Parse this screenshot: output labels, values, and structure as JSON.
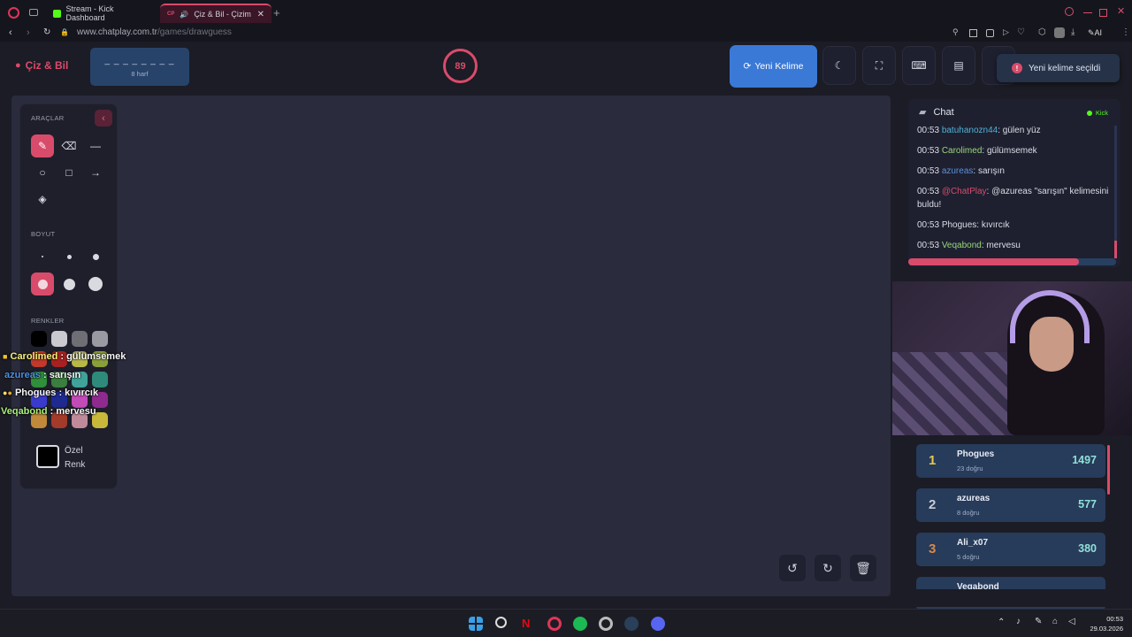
{
  "browser": {
    "tabs": [
      {
        "label": "Stream - Kick Dashboard"
      },
      {
        "label": "Çiz & Bil - Çizim Oy"
      }
    ],
    "url_domain": "www.chatplay.com.tr",
    "url_path": "/games/drawguess",
    "ai_label": "AI"
  },
  "header": {
    "app_title": "Çiz & Bil",
    "word_mask": "_ _ _ _ _ _ _ _",
    "word_length": "8 harf",
    "timer": "89",
    "new_word_label": "Yeni Kelime",
    "toast": "Yeni kelime seçildi"
  },
  "tools": {
    "section_tools": "ARAÇLAR",
    "section_size": "BOYUT",
    "section_colors": "RENKLER",
    "custom_color_line1": "Özel",
    "custom_color_line2": "Renk",
    "colors": [
      "#000000",
      "#c9c9cf",
      "#6e6e74",
      "#9a9aa2",
      "#c0392b",
      "#a82121",
      "#b8b84a",
      "#8a9e3a",
      "#2f8f3a",
      "#3b7f3f",
      "#3fa39a",
      "#2e8a7a",
      "#3a3acc",
      "#1e2a8f",
      "#c24bb8",
      "#8f2a8f",
      "#c08a3a",
      "#a33a2a",
      "#c08a9a",
      "#c9b83a"
    ]
  },
  "overlay_chat": [
    {
      "user": "Carolimed",
      "text": "gülümsemek",
      "user_color": "#f5f07a"
    },
    {
      "user": "azureas",
      "text": "sarışın",
      "user_color": "#4f8fe0"
    },
    {
      "user": "Phogues",
      "text": "kıvırcık",
      "user_color": "#f7f7f7"
    },
    {
      "user": "Veqabond",
      "text": "mervesu",
      "user_color": "#a8f07a"
    }
  ],
  "chat": {
    "title": "Chat",
    "platform": "Kick",
    "messages": [
      {
        "time": "00:53",
        "user": "batuhanozn44",
        "sep": ": ",
        "text": "gülen yüz",
        "user_color": "#4fb3d9"
      },
      {
        "time": "00:53",
        "user": "Carolimed",
        "sep": ": ",
        "text": "gülümsemek",
        "user_color": "#9bd67a"
      },
      {
        "time": "00:53",
        "user": "azureas",
        "sep": ": ",
        "text": "sarışın",
        "user_color": "#5b8fd9"
      },
      {
        "time": "00:53",
        "user": "@ChatPlay",
        "sep": ": ",
        "text": "@azureas \"sarışın\" kelimesini buldu!",
        "user_color": "#d94b6b"
      },
      {
        "time": "00:53",
        "user": "Phogues",
        "sep": ": ",
        "text": "kıvırcık",
        "user_color": "#dcdde6"
      },
      {
        "time": "00:53",
        "user": "Veqabond",
        "sep": ": ",
        "text": "mervesu",
        "user_color": "#9bd67a"
      }
    ],
    "timer_progress": 0.82
  },
  "leaderboard": [
    {
      "rank": "1",
      "name": "Phogues",
      "correct": "23 doğru",
      "score": "1497",
      "rank_color": "#e8c94a"
    },
    {
      "rank": "2",
      "name": "azureas",
      "correct": "8 doğru",
      "score": "577",
      "rank_color": "#c9ccd6"
    },
    {
      "rank": "3",
      "name": "Ali_x07",
      "correct": "5 doğru",
      "score": "380",
      "rank_color": "#d9894a"
    },
    {
      "rank": "",
      "name": "Veqabond",
      "correct": "",
      "score": "",
      "rank_color": "#c9ccd6"
    }
  ],
  "taskbar": {
    "time": "00:53",
    "date": "29.03.2026"
  }
}
